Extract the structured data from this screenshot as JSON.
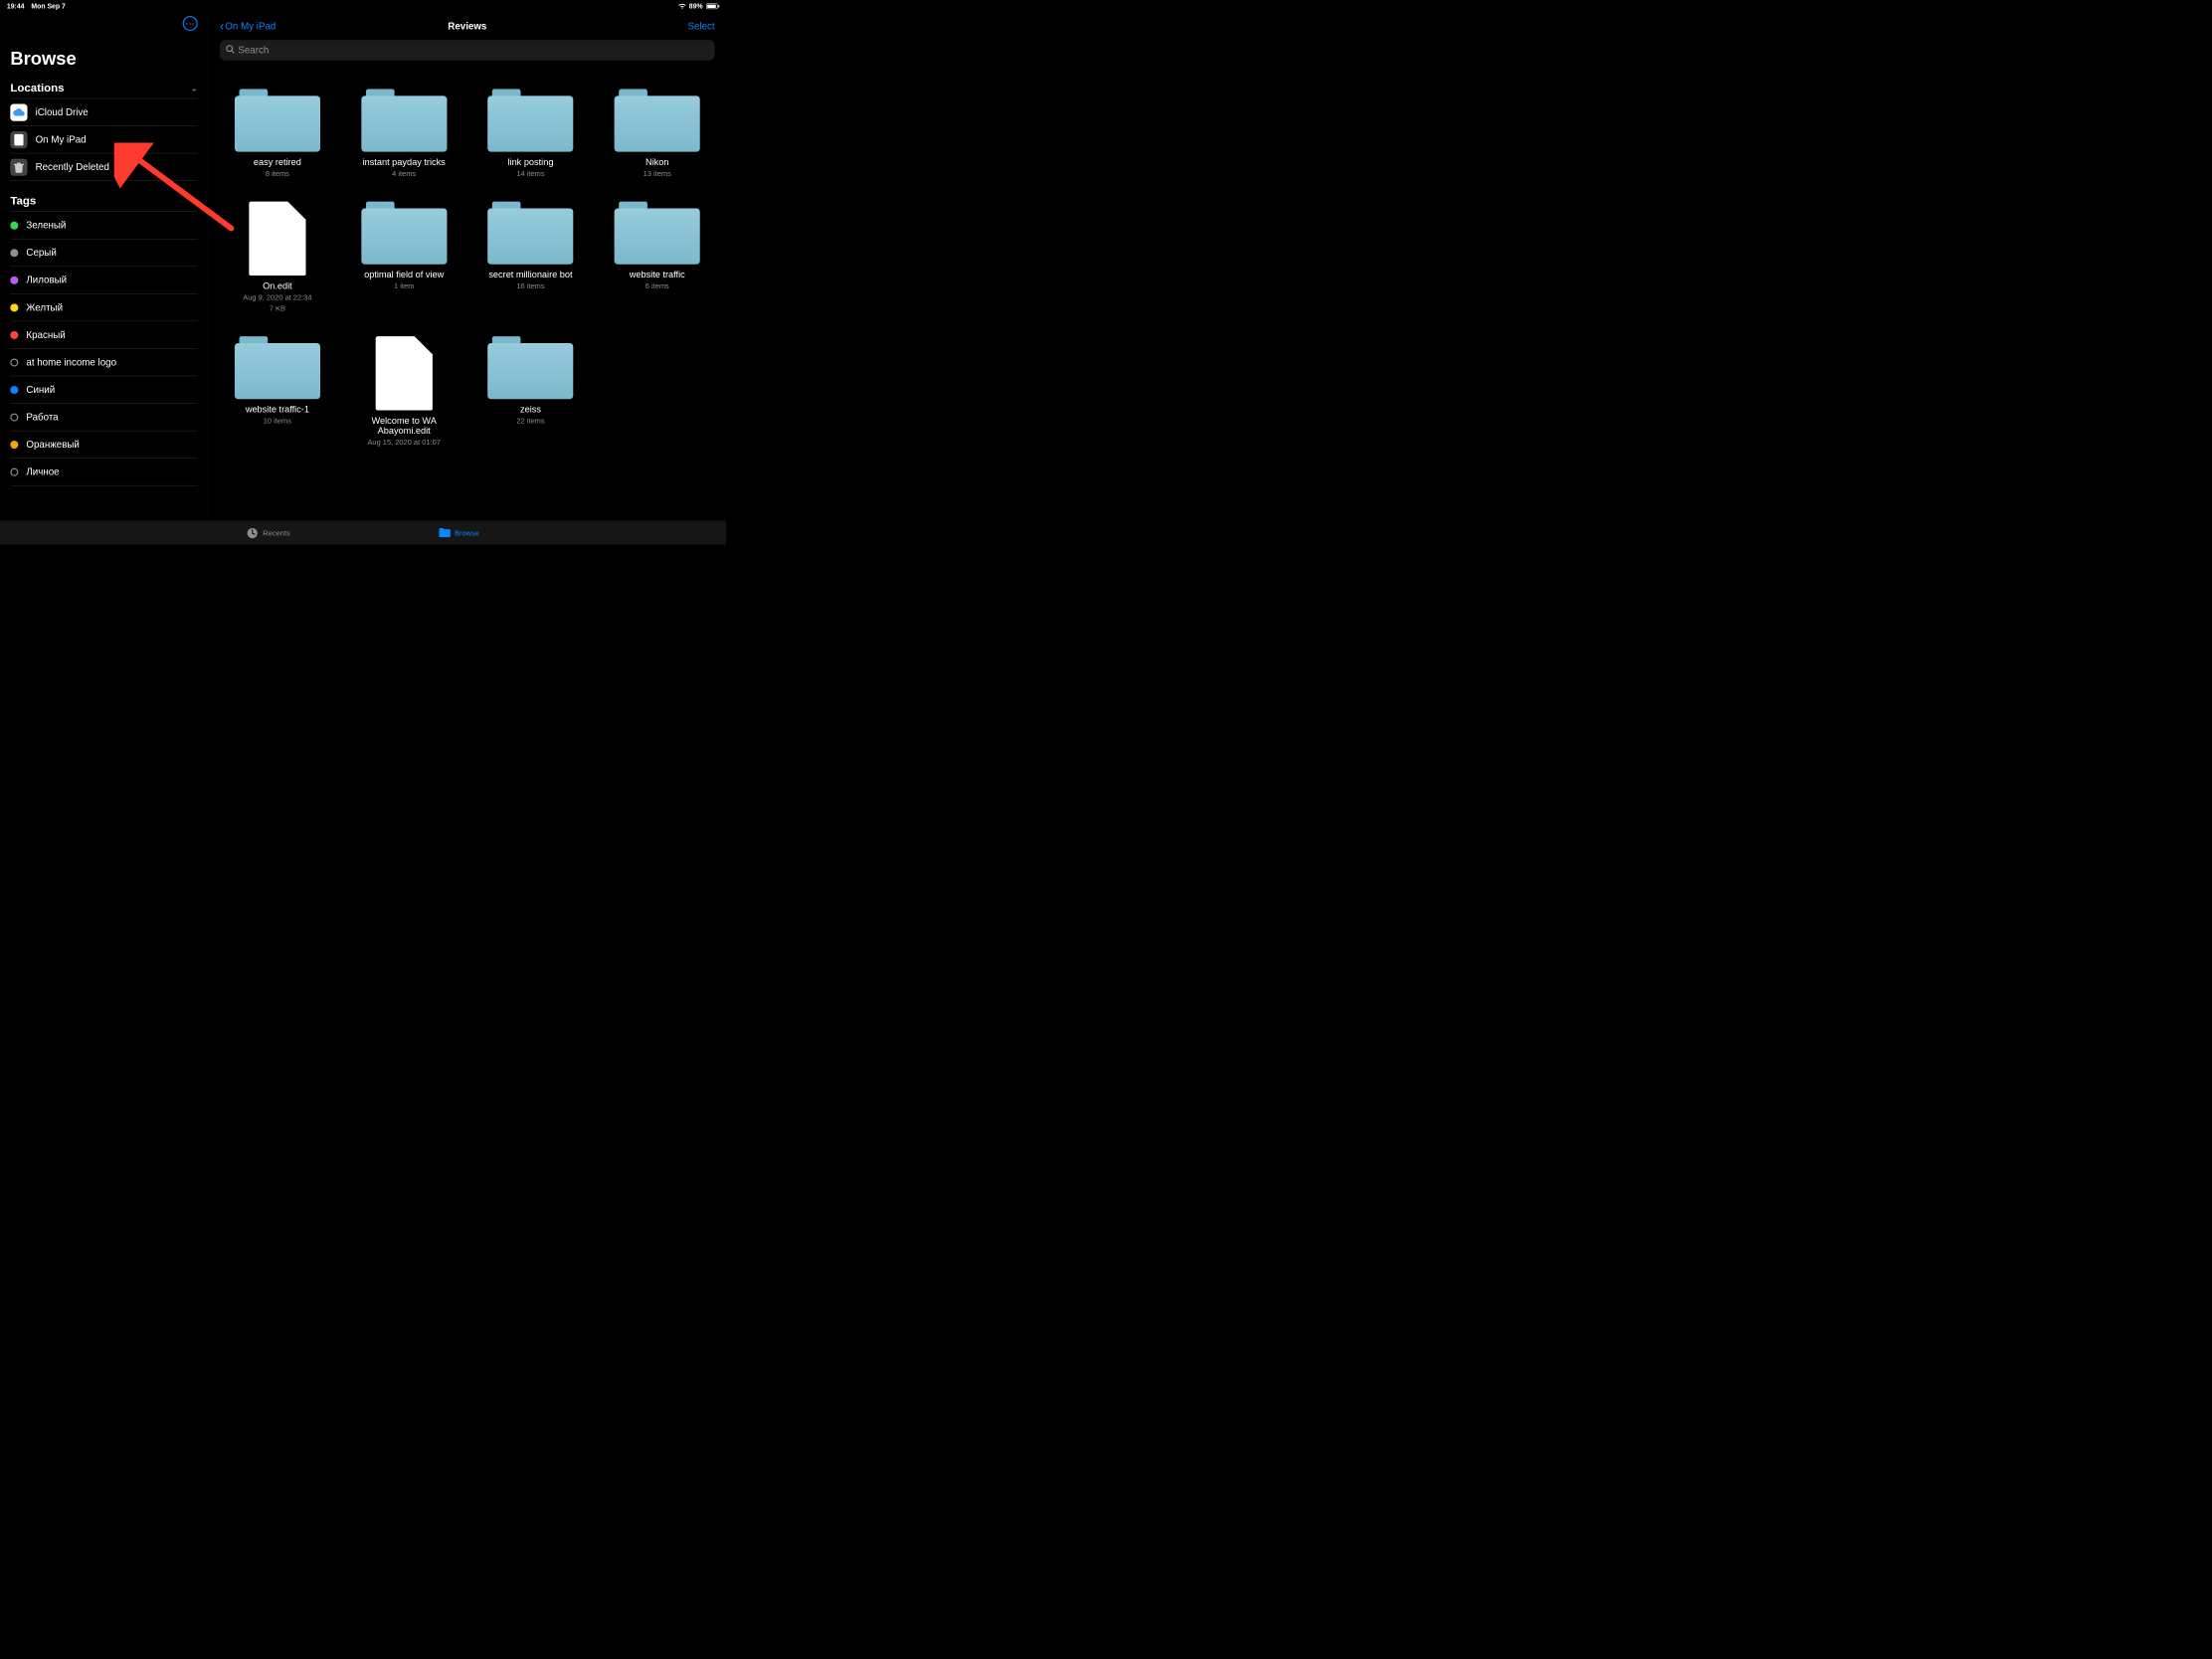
{
  "statusbar": {
    "time": "19:44",
    "date": "Mon Sep 7",
    "battery": "89%"
  },
  "sidebar": {
    "more_icon": "more-options",
    "title": "Browse",
    "locations_header": "Locations",
    "tags_header": "Tags",
    "locations": [
      {
        "icon": "cloud",
        "label": "iCloud Drive"
      },
      {
        "icon": "ipad",
        "label": "On My iPad"
      },
      {
        "icon": "trash",
        "label": "Recently Deleted"
      }
    ],
    "tags": [
      {
        "color": "#32d74b",
        "label": "Зеленый"
      },
      {
        "color": "#8e8e93",
        "label": "Серый"
      },
      {
        "color": "#bf5af2",
        "label": "Лиловый"
      },
      {
        "color": "#ffd60a",
        "label": "Желтый"
      },
      {
        "color": "#ff453a",
        "label": "Красный"
      },
      {
        "color": "",
        "outline": true,
        "label": "at home income logo"
      },
      {
        "color": "#0a84ff",
        "label": "Синий"
      },
      {
        "color": "",
        "outline": true,
        "label": "Работа"
      },
      {
        "color": "#ff9f0a",
        "label": "Оранжевый"
      },
      {
        "color": "",
        "outline": true,
        "label": "Личное"
      }
    ]
  },
  "nav": {
    "back_label": "On My iPad",
    "title": "Reviews",
    "select_label": "Select"
  },
  "search": {
    "placeholder": "Search"
  },
  "items": [
    {
      "type": "folder",
      "name": "easy retired",
      "sub": "8 items"
    },
    {
      "type": "folder",
      "name": "instant payday tricks",
      "sub": "4 items"
    },
    {
      "type": "folder",
      "name": "link posting",
      "sub": "14 items"
    },
    {
      "type": "folder",
      "name": "Nikon",
      "sub": "13 items"
    },
    {
      "type": "file",
      "name": "On.edit",
      "sub": "Aug 9, 2020 at 22:34\n7 KB"
    },
    {
      "type": "folder",
      "name": "optimal field of view",
      "sub": "1 item"
    },
    {
      "type": "folder",
      "name": "secret millionaire bot",
      "sub": "16 items"
    },
    {
      "type": "folder",
      "name": "website traffic",
      "sub": "6 items"
    },
    {
      "type": "folder",
      "name": "website traffic-1",
      "sub": "10 items"
    },
    {
      "type": "file",
      "name": "Welcome to WA Abayomi.edit",
      "sub": "Aug 15, 2020 at 01:07"
    },
    {
      "type": "folder",
      "name": "zeiss",
      "sub": "22 items"
    }
  ],
  "tabbar": {
    "recents": "Recents",
    "browse": "Browse"
  },
  "colors": {
    "accent": "#0a84ff"
  }
}
